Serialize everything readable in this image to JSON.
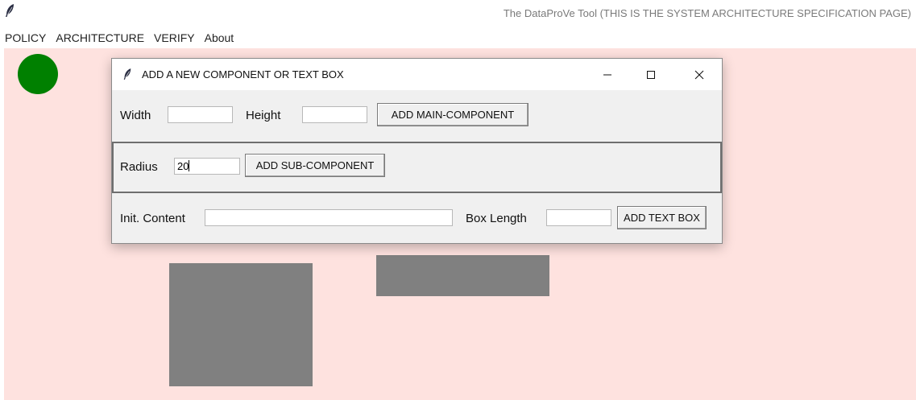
{
  "app": {
    "title": "The DataProVe Tool (THIS IS THE SYSTEM ARCHITECTURE SPECIFICATION PAGE)",
    "icon": "feather-icon"
  },
  "menu": {
    "items": [
      {
        "label": "POLICY"
      },
      {
        "label": "ARCHITECTURE"
      },
      {
        "label": "VERIFY"
      },
      {
        "label": "About"
      }
    ]
  },
  "canvas": {
    "background": "#fee2df",
    "shapes": [
      {
        "kind": "circle",
        "color": "#008000"
      },
      {
        "kind": "rectangle",
        "color": "#808080"
      },
      {
        "kind": "rectangle",
        "color": "#808080"
      }
    ]
  },
  "dialog": {
    "title": "ADD A NEW COMPONENT OR TEXT BOX",
    "icon": "feather-icon",
    "controls": {
      "minimize": "minimize-icon",
      "maximize": "maximize-icon",
      "close": "close-icon"
    },
    "main_component": {
      "width_label": "Width",
      "width_value": "",
      "height_label": "Height",
      "height_value": "",
      "button": "ADD MAIN-COMPONENT"
    },
    "sub_component": {
      "radius_label": "Radius",
      "radius_value": "20",
      "button": "ADD SUB-COMPONENT"
    },
    "text_box": {
      "content_label": "Init. Content",
      "content_value": "",
      "length_label": "Box Length",
      "length_value": "",
      "button": "ADD TEXT BOX"
    }
  }
}
